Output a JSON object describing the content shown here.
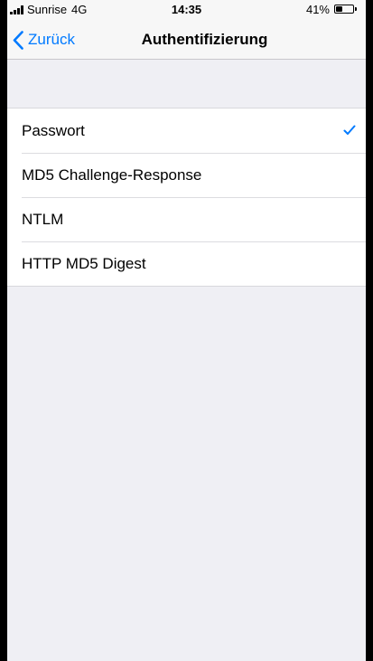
{
  "status_bar": {
    "carrier": "Sunrise",
    "network": "4G",
    "time": "14:35",
    "battery_percent": "41%",
    "battery_level": 0.41,
    "icons": [
      "signal-bars-icon",
      "battery-icon"
    ]
  },
  "nav": {
    "back_label": "Zurück",
    "back_icon": "chevron-left-icon",
    "title": "Authentifizierung"
  },
  "options": {
    "items": [
      {
        "label": "Passwort",
        "selected": true
      },
      {
        "label": "MD5 Challenge-Response",
        "selected": false
      },
      {
        "label": "NTLM",
        "selected": false
      },
      {
        "label": "HTTP MD5 Digest",
        "selected": false
      }
    ],
    "check_icon": "checkmark-icon"
  },
  "colors": {
    "accent": "#007aff",
    "background": "#efeff4",
    "bar": "#f7f7f7",
    "cell": "#ffffff"
  }
}
